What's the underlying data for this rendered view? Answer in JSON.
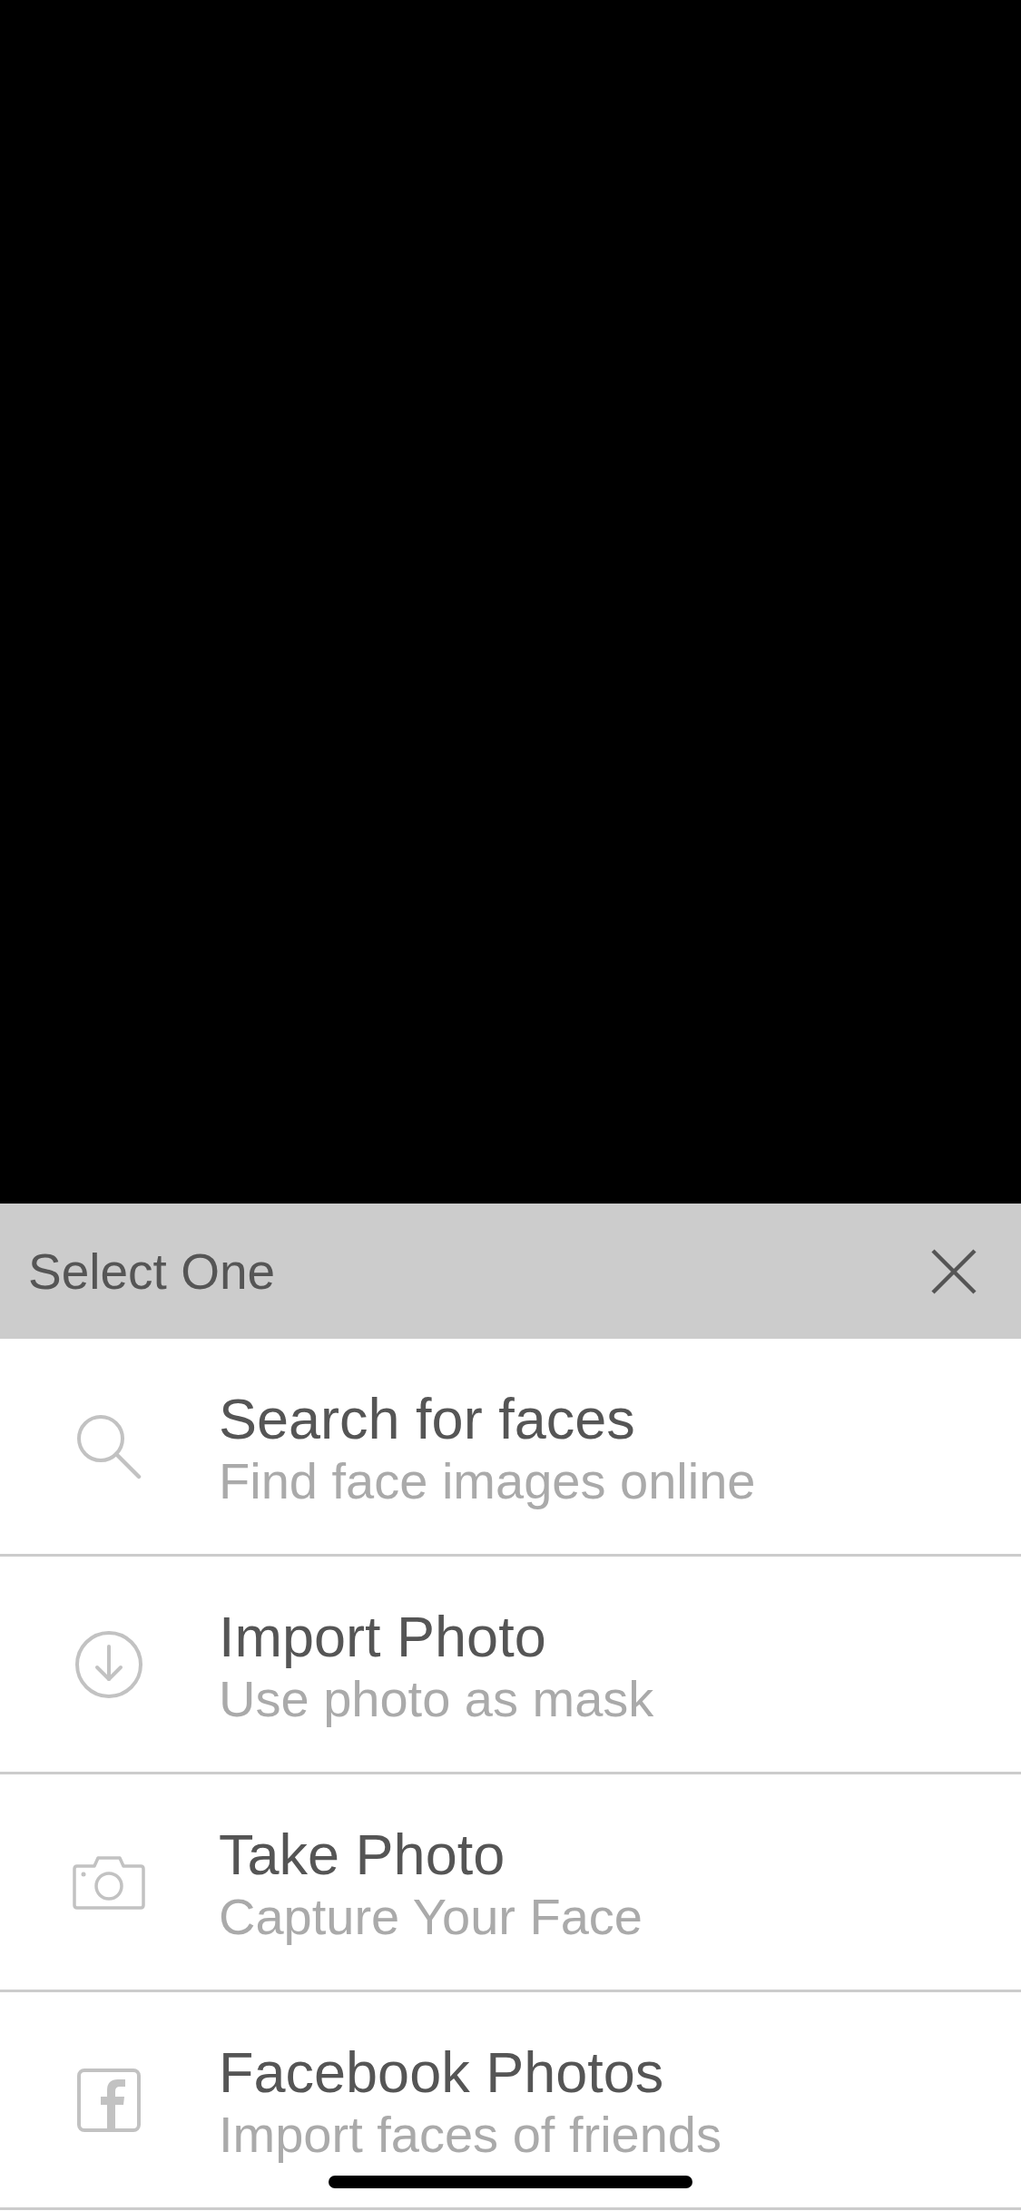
{
  "header": {
    "title": "Select One"
  },
  "options": [
    {
      "kind": "search",
      "title": "Search for faces",
      "subtitle": "Find face images online"
    },
    {
      "kind": "import",
      "title": "Import Photo",
      "subtitle": "Use photo as mask"
    },
    {
      "kind": "camera",
      "title": "Take Photo",
      "subtitle": "Capture Your Face"
    },
    {
      "kind": "facebook",
      "title": "Facebook Photos",
      "subtitle": "Import faces of friends"
    }
  ]
}
